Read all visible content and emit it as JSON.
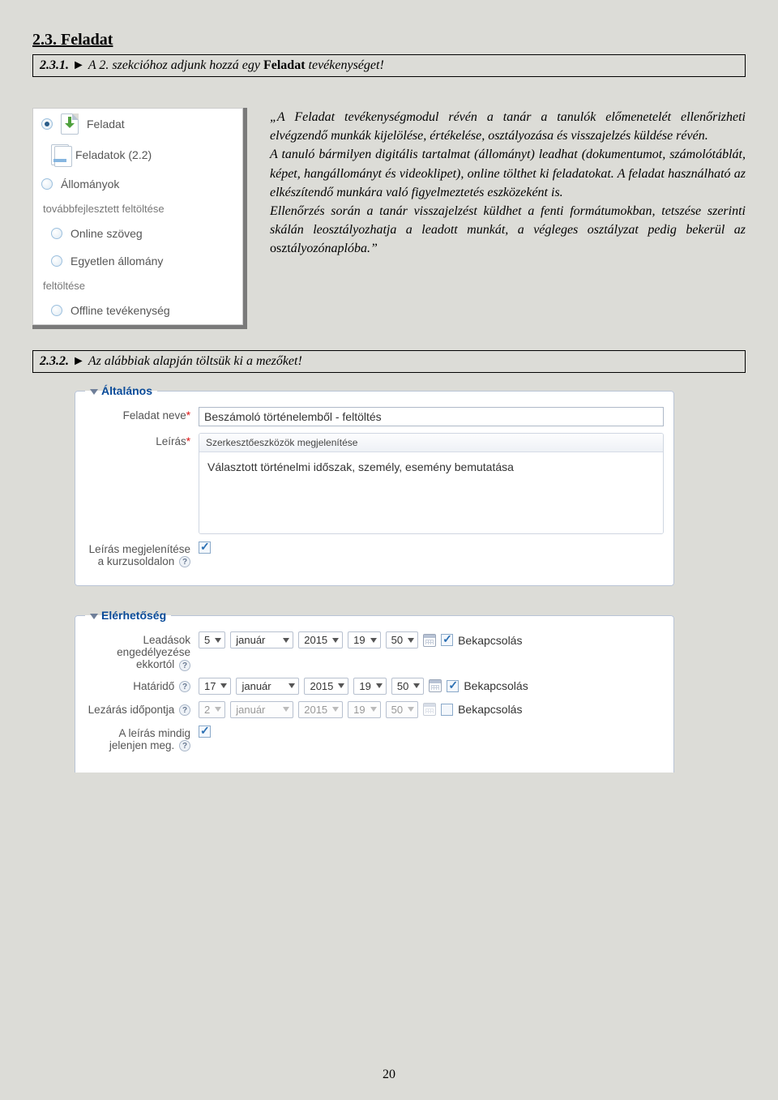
{
  "page_number": "20",
  "section_title": "2.3. Feladat",
  "task1": {
    "num": "2.3.1.",
    "arrow": "►",
    "line_pre": "A 2. szekcióhoz adjunk hozzá egy ",
    "bold": "Feladat",
    "line_post": " tevékenységet!"
  },
  "panel": {
    "items": [
      {
        "kind": "radio-selected",
        "label": "Feladat",
        "icon": "file-arrow"
      },
      {
        "kind": "plain-sub",
        "label": "Feladatok (2.2)",
        "icon": "file-stack"
      },
      {
        "kind": "radio",
        "label": "Állományok"
      },
      {
        "kind": "note",
        "label": "továbbfejlesztett feltöltése"
      },
      {
        "kind": "radio-sub",
        "label": "Online szöveg"
      },
      {
        "kind": "radio-sub",
        "label": "Egyetlen állomány"
      },
      {
        "kind": "note",
        "label": "feltöltése"
      },
      {
        "kind": "radio-sub",
        "label": "Offline tevékenység"
      }
    ]
  },
  "quote": "„A Feladat tevékenységmodul révén a tanár a tanulók előmenetelét ellenőrizheti elvégzendő munkák kijelölése, értékelése, osztályozása és visszajelzés küldése révén.\nA tanuló bármilyen digitális tartalmat (állományt) leadhat (dokumentumot, számolótáblát, képet, hangállományt és videoklipet), online tölthet ki feladatokat. A feladat használható az elkészítendő munkára való figyelmeztetés eszközeként is.\nEllenőrzés során a tanár visszajelzést küldhet a fenti formátumokban, tetszése szerinti skálán leosztályozhatja a leadott munkát, a végleges osztályzat pedig bekerül az ",
  "quote_tail_normal_prefix": "oszt",
  "quote_tail_italic": "ályozónaplóba.”",
  "task2": {
    "num": "2.3.2.",
    "arrow": "►",
    "text": "Az alábbiak alapján töltsük ki a mezőket!"
  },
  "form": {
    "general_legend": "Általános",
    "name_label": "Feladat neve",
    "name_value": "Beszámoló történelemből - feltöltés",
    "desc_label": "Leírás",
    "toolbar": "Szerkesztőeszközök megjelenítése",
    "desc_value": "Választott történelmi időszak, személy, esemény bemutatása",
    "showdesc_label": "Leírás megjelenítése a kurzusoldalon",
    "avail_legend": "Elérhetőség",
    "rows": [
      {
        "label": "Leadások engedélyezése ekkortól",
        "help": true,
        "day": "5",
        "month": "január",
        "year": "2015",
        "hour": "19",
        "min": "50",
        "enabled": true,
        "trail": "Bekapcsolás"
      },
      {
        "label": "Határidő",
        "help": true,
        "day": "17",
        "month": "január",
        "year": "2015",
        "hour": "19",
        "min": "50",
        "enabled": true,
        "trail": "Bekapcsolás"
      },
      {
        "label": "Lezárás időpontja",
        "help": true,
        "day": "2",
        "month": "január",
        "year": "2015",
        "hour": "19",
        "min": "50",
        "enabled": false,
        "trail": "Bekapcsolás"
      }
    ],
    "alwaysshow_label": "A leírás mindig jelenjen meg."
  }
}
